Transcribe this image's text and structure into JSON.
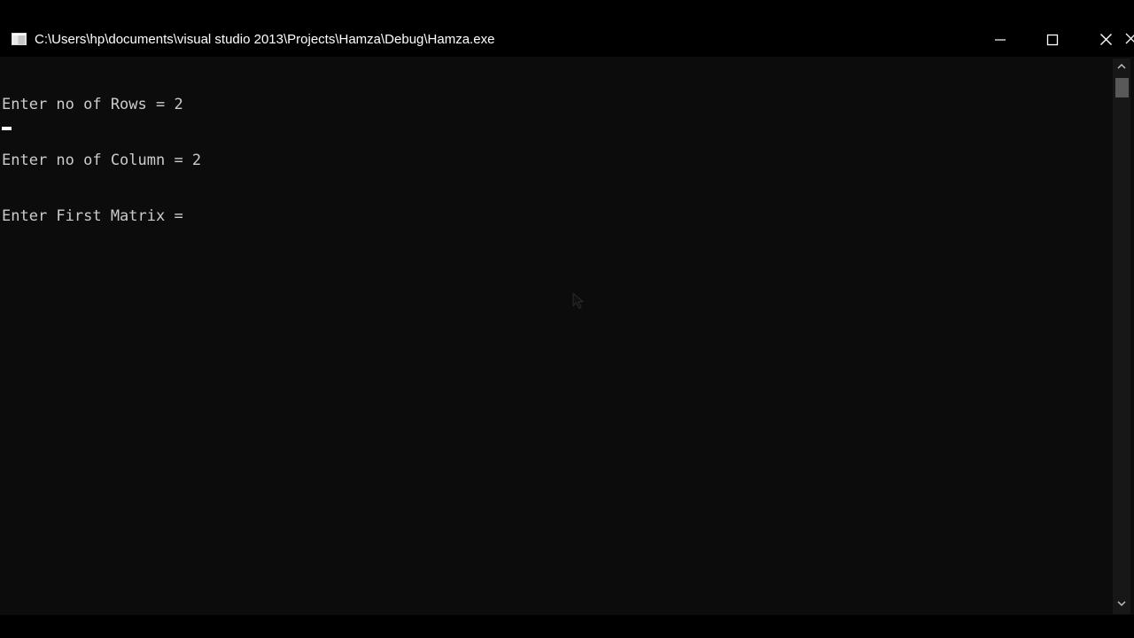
{
  "window": {
    "title": "C:\\Users\\hp\\documents\\visual studio 2013\\Projects\\Hamza\\Debug\\Hamza.exe",
    "icon": "console-app-icon",
    "controls": [
      "minimize-icon",
      "maximize-icon",
      "close-icon"
    ]
  },
  "console": {
    "lines": [
      "Enter no of Rows = 2",
      "Enter no of Column = 2",
      "Enter First Matrix ="
    ]
  },
  "colors": {
    "background": "#0c0c0c",
    "text": "#cccccc",
    "titlebar": "#000000"
  }
}
